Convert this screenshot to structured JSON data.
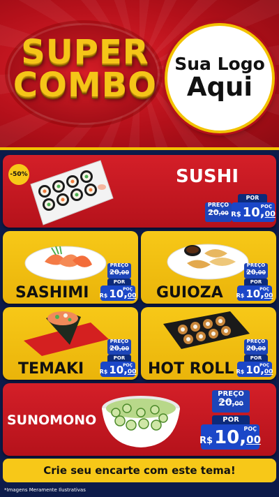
{
  "header": {
    "title_line1": "SUPER",
    "title_line2": "COMBO",
    "logo_line1": "Sua Logo",
    "logo_line2": "Aqui"
  },
  "products": {
    "sushi": {
      "name": "SUSHI",
      "badge": "-50%",
      "old_label": "PREÇO",
      "old_price_main": "20",
      "old_price_cents": "00",
      "por_label": "POR",
      "currency": "R$",
      "new_price_main": "10",
      "new_price_cents": "00",
      "poc": "POÇ"
    },
    "sashimi": {
      "name": "SASHIMI",
      "old_label": "PREÇO",
      "old_price_main": "20",
      "old_price_cents": "00",
      "por_label": "POR",
      "currency": "R$",
      "new_price_main": "10",
      "new_price_cents": "00",
      "poc": "POÇ"
    },
    "guioza": {
      "name": "GUIOZA",
      "old_label": "PREÇO",
      "old_price_main": "20",
      "old_price_cents": "00",
      "por_label": "POR",
      "currency": "R$",
      "new_price_main": "10",
      "new_price_cents": "00",
      "poc": "POÇ"
    },
    "temaki": {
      "name": "TEMAKI",
      "old_label": "PREÇO",
      "old_price_main": "20",
      "old_price_cents": "00",
      "por_label": "POR",
      "currency": "R$",
      "new_price_main": "10",
      "new_price_cents": "00",
      "poc": "POÇ"
    },
    "hotroll": {
      "name": "HOT ROLL",
      "old_label": "PREÇO",
      "old_price_main": "20",
      "old_price_cents": "00",
      "por_label": "POR",
      "currency": "R$",
      "new_price_main": "10",
      "new_price_cents": "00",
      "poc": "POÇ"
    },
    "sunomono": {
      "name": "SUNOMONO",
      "old_label": "PREÇO",
      "old_price_main": "20",
      "old_price_cents": "00",
      "por_label": "POR",
      "currency": "R$",
      "new_price_main": "10",
      "new_price_cents": "00",
      "poc": "POÇ"
    }
  },
  "cta": "Crie seu encarte com este tema!",
  "footnote": "*Imagens Meramente Ilustrativas",
  "colors": {
    "red": "#d41f28",
    "yellow": "#f7c818",
    "navy": "#0d1b4a",
    "price_blue": "#1b47c8"
  }
}
